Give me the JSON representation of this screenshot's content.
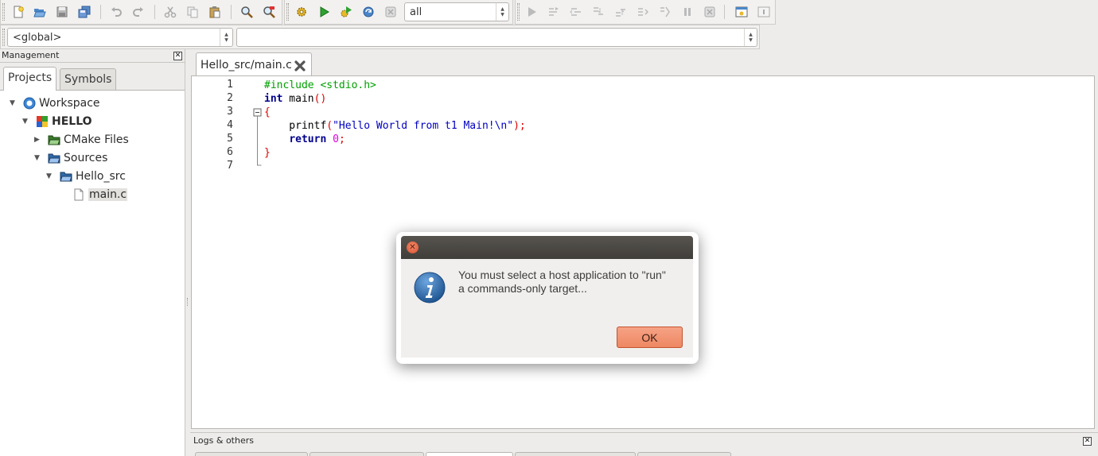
{
  "toolbar": {
    "build_target": "all",
    "buttons": [
      "new-file",
      "open",
      "save",
      "save-all",
      "undo",
      "redo",
      "cut",
      "copy",
      "paste",
      "find",
      "replace",
      "build",
      "run",
      "build-and-run",
      "rebuild",
      "abort",
      "debug-run",
      "run-to-cursor",
      "next-line",
      "step-into",
      "step-out",
      "next-instruction",
      "step-into-instruction",
      "break-debugger",
      "stop-debugger",
      "debugging-windows",
      "various-info"
    ]
  },
  "code_completion": {
    "scope": "<global>",
    "function": ""
  },
  "management": {
    "title": "Management",
    "tabs": [
      "Projects",
      "Symbols"
    ],
    "active_tab": "Projects",
    "tree": [
      {
        "label": "Workspace",
        "level": 0,
        "expanded": true,
        "icon": "workspace-icon"
      },
      {
        "label": "HELLO",
        "level": 1,
        "expanded": true,
        "icon": "project-icon",
        "bold": true
      },
      {
        "label": "CMake Files",
        "level": 2,
        "expanded": false,
        "icon": "folder-icon"
      },
      {
        "label": "Sources",
        "level": 2,
        "expanded": true,
        "icon": "folder-open-icon"
      },
      {
        "label": "Hello_src",
        "level": 3,
        "expanded": true,
        "icon": "folder-open-icon"
      },
      {
        "label": "main.c",
        "level": 4,
        "icon": "file-icon",
        "selected": true
      }
    ]
  },
  "editor": {
    "tab_label": "Hello_src/main.c",
    "line_numbers": [
      "1",
      "2",
      "3",
      "4",
      "5",
      "6",
      "7"
    ],
    "lines": [
      [
        {
          "t": "#include <stdio.h>",
          "c": "pp"
        }
      ],
      [
        {
          "t": "int",
          "c": "kw"
        },
        {
          "t": " main",
          "c": "fn"
        },
        {
          "t": "()",
          "c": "br"
        }
      ],
      [
        {
          "t": "{",
          "c": "br"
        }
      ],
      [
        {
          "t": "    printf",
          "c": "fn"
        },
        {
          "t": "(",
          "c": "br"
        },
        {
          "t": "\"Hello World from t1 Main!\\n\"",
          "c": "str"
        },
        {
          "t": ");",
          "c": "br"
        }
      ],
      [
        {
          "t": "    ",
          "c": "pl"
        },
        {
          "t": "return",
          "c": "kw"
        },
        {
          "t": " ",
          "c": "pl"
        },
        {
          "t": "0",
          "c": "num"
        },
        {
          "t": ";",
          "c": "br"
        }
      ],
      [
        {
          "t": "}",
          "c": "br"
        }
      ],
      [
        {
          "t": "",
          "c": "pl"
        }
      ]
    ]
  },
  "logs": {
    "title": "Logs & others"
  },
  "dialog": {
    "message_line1": "You must select a host application to \"run\"",
    "message_line2": "a commands-only target...",
    "ok_label": "OK",
    "icon": "info-icon"
  },
  "colors": {
    "accent_orange": "#e8774a",
    "dialog_titlebar": "#4a4844",
    "info_blue": "#2f6aa7"
  }
}
